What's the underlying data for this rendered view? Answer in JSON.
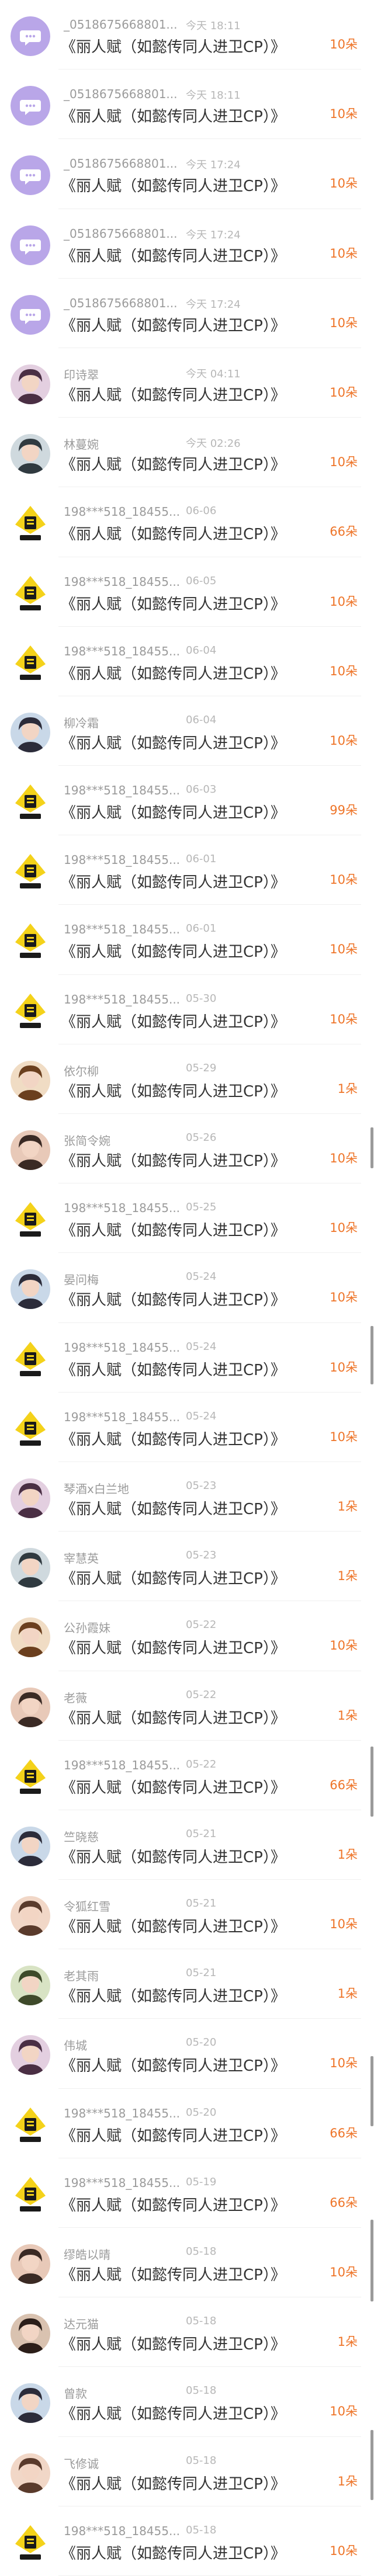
{
  "gift_list": {
    "items": [
      {
        "avatar": "chat-bubble",
        "name": "_0518675668801...",
        "time": "今天 18:11",
        "title": "《丽人赋（如懿传同人进卫CP）》",
        "amount": "10朵"
      },
      {
        "avatar": "chat-bubble",
        "name": "_0518675668801...",
        "time": "今天 18:11",
        "title": "《丽人赋（如懿传同人进卫CP）》",
        "amount": "10朵"
      },
      {
        "avatar": "chat-bubble",
        "name": "_0518675668801...",
        "time": "今天 17:24",
        "title": "《丽人赋（如懿传同人进卫CP）》",
        "amount": "10朵"
      },
      {
        "avatar": "chat-bubble",
        "name": "_0518675668801...",
        "time": "今天 17:24",
        "title": "《丽人赋（如懿传同人进卫CP）》",
        "amount": "10朵"
      },
      {
        "avatar": "chat-bubble",
        "name": "_0518675668801...",
        "time": "今天 17:24",
        "title": "《丽人赋（如懿传同人进卫CP）》",
        "amount": "10朵"
      },
      {
        "avatar": "photo",
        "name": "印诗翠",
        "time": "今天 04:11",
        "title": "《丽人赋（如懿传同人进卫CP）》",
        "amount": "10朵"
      },
      {
        "avatar": "photo",
        "name": "林蔓婉",
        "time": "今天 02:26",
        "title": "《丽人赋（如懿传同人进卫CP）》",
        "amount": "10朵"
      },
      {
        "avatar": "reader-badge",
        "name": "198***518_18455...",
        "time": "06-06",
        "title": "《丽人赋（如懿传同人进卫CP）》",
        "amount": "66朵"
      },
      {
        "avatar": "reader-badge",
        "name": "198***518_18455...",
        "time": "06-05",
        "title": "《丽人赋（如懿传同人进卫CP）》",
        "amount": "10朵"
      },
      {
        "avatar": "reader-badge",
        "name": "198***518_18455...",
        "time": "06-04",
        "title": "《丽人赋（如懿传同人进卫CP）》",
        "amount": "10朵"
      },
      {
        "avatar": "photo",
        "name": "柳冷霜",
        "time": "06-04",
        "title": "《丽人赋（如懿传同人进卫CP）》",
        "amount": "10朵"
      },
      {
        "avatar": "reader-badge",
        "name": "198***518_18455...",
        "time": "06-03",
        "title": "《丽人赋（如懿传同人进卫CP）》",
        "amount": "99朵"
      },
      {
        "avatar": "reader-badge",
        "name": "198***518_18455...",
        "time": "06-01",
        "title": "《丽人赋（如懿传同人进卫CP）》",
        "amount": "10朵"
      },
      {
        "avatar": "reader-badge",
        "name": "198***518_18455...",
        "time": "06-01",
        "title": "《丽人赋（如懿传同人进卫CP）》",
        "amount": "10朵"
      },
      {
        "avatar": "reader-badge",
        "name": "198***518_18455...",
        "time": "05-30",
        "title": "《丽人赋（如懿传同人进卫CP）》",
        "amount": "10朵"
      },
      {
        "avatar": "photo",
        "name": "依尔柳",
        "time": "05-29",
        "title": "《丽人赋（如懿传同人进卫CP）》",
        "amount": "1朵"
      },
      {
        "avatar": "photo",
        "name": "张简令婉",
        "time": "05-26",
        "title": "《丽人赋（如懿传同人进卫CP）》",
        "amount": "10朵"
      },
      {
        "avatar": "reader-badge",
        "name": "198***518_18455...",
        "time": "05-25",
        "title": "《丽人赋（如懿传同人进卫CP）》",
        "amount": "10朵"
      },
      {
        "avatar": "photo",
        "name": "晏问梅",
        "time": "05-24",
        "title": "《丽人赋（如懿传同人进卫CP）》",
        "amount": "10朵"
      },
      {
        "avatar": "reader-badge",
        "name": "198***518_18455...",
        "time": "05-24",
        "title": "《丽人赋（如懿传同人进卫CP）》",
        "amount": "10朵"
      },
      {
        "avatar": "reader-badge",
        "name": "198***518_18455...",
        "time": "05-24",
        "title": "《丽人赋（如懿传同人进卫CP）》",
        "amount": "10朵"
      },
      {
        "avatar": "photo",
        "name": "琴酒x白兰地",
        "time": "05-23",
        "title": "《丽人赋（如懿传同人进卫CP）》",
        "amount": "1朵"
      },
      {
        "avatar": "photo",
        "name": "宰慧英",
        "time": "05-23",
        "title": "《丽人赋（如懿传同人进卫CP）》",
        "amount": "1朵"
      },
      {
        "avatar": "photo",
        "name": "公孙霞妹",
        "time": "05-22",
        "title": "《丽人赋（如懿传同人进卫CP）》",
        "amount": "10朵"
      },
      {
        "avatar": "photo",
        "name": "老薇",
        "time": "05-22",
        "title": "《丽人赋（如懿传同人进卫CP）》",
        "amount": "1朵"
      },
      {
        "avatar": "reader-badge",
        "name": "198***518_18455...",
        "time": "05-22",
        "title": "《丽人赋（如懿传同人进卫CP）》",
        "amount": "66朵"
      },
      {
        "avatar": "photo",
        "name": "竺晓慈",
        "time": "05-21",
        "title": "《丽人赋（如懿传同人进卫CP）》",
        "amount": "1朵"
      },
      {
        "avatar": "photo",
        "name": "令狐红雪",
        "time": "05-21",
        "title": "《丽人赋（如懿传同人进卫CP）》",
        "amount": "10朵"
      },
      {
        "avatar": "photo",
        "name": "老其雨",
        "time": "05-21",
        "title": "《丽人赋（如懿传同人进卫CP）》",
        "amount": "1朵"
      },
      {
        "avatar": "photo",
        "name": "伟城",
        "time": "05-20",
        "title": "《丽人赋（如懿传同人进卫CP）》",
        "amount": "10朵"
      },
      {
        "avatar": "reader-badge",
        "name": "198***518_18455...",
        "time": "05-20",
        "title": "《丽人赋（如懿传同人进卫CP）》",
        "amount": "66朵"
      },
      {
        "avatar": "reader-badge",
        "name": "198***518_18455...",
        "time": "05-19",
        "title": "《丽人赋（如懿传同人进卫CP）》",
        "amount": "66朵"
      },
      {
        "avatar": "photo",
        "name": "缪皓以晴",
        "time": "05-18",
        "title": "《丽人赋（如懿传同人进卫CP）》",
        "amount": "10朵"
      },
      {
        "avatar": "photo",
        "name": "达元猫",
        "time": "05-18",
        "title": "《丽人赋（如懿传同人进卫CP）》",
        "amount": "1朵"
      },
      {
        "avatar": "photo",
        "name": "曾款",
        "time": "05-18",
        "title": "《丽人赋（如懿传同人进卫CP）》",
        "amount": "10朵"
      },
      {
        "avatar": "photo",
        "name": "飞修诚",
        "time": "05-18",
        "title": "《丽人赋（如懿传同人进卫CP）》",
        "amount": "1朵"
      },
      {
        "avatar": "reader-badge",
        "name": "198***518_18455...",
        "time": "05-18",
        "title": "《丽人赋（如懿传同人进卫CP）》",
        "amount": "10朵"
      }
    ]
  },
  "colors": {
    "amount": "#ee7428",
    "bubble_avatar": "#b9a6e8",
    "badge_yellow": "#f4d21a"
  }
}
